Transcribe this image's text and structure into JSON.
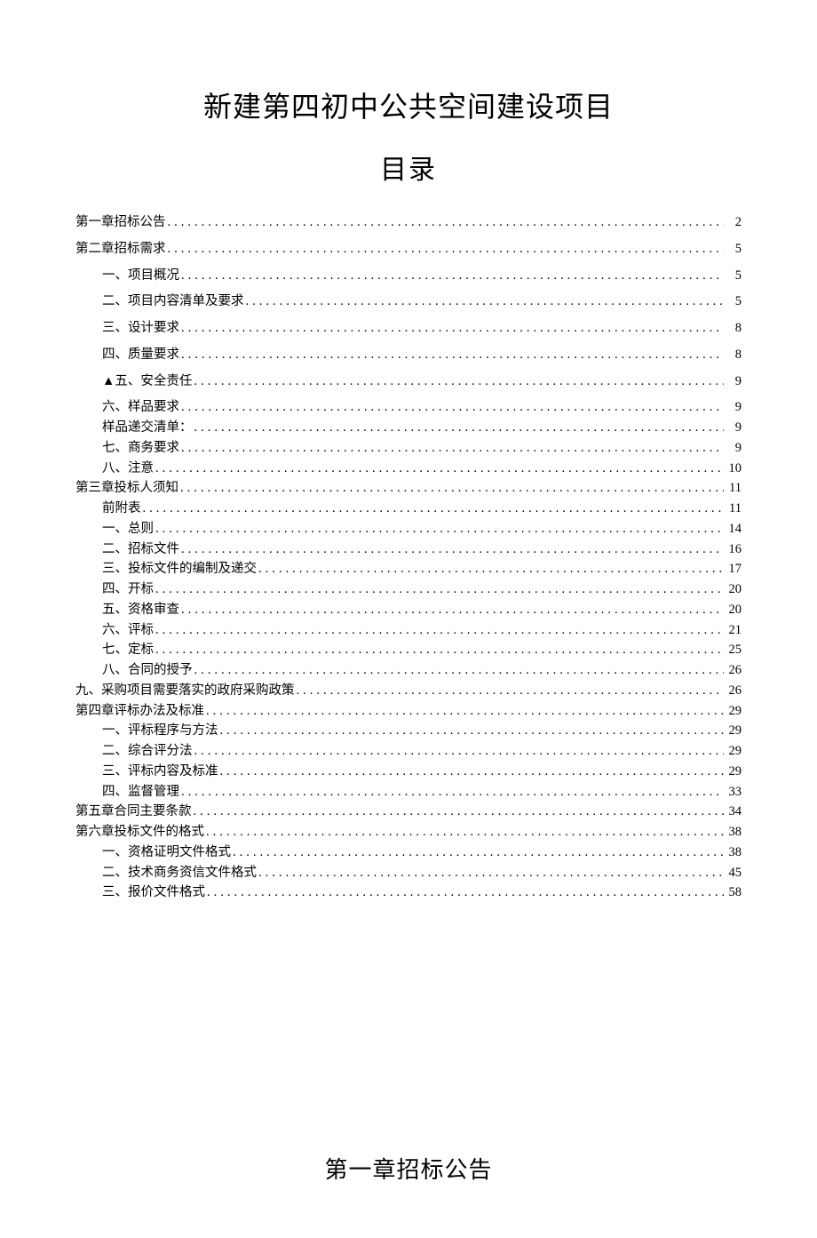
{
  "title": "新建第四初中公共空间建设项目",
  "subtitle": "目录",
  "chapter_heading": "第一章招标公告",
  "toc": [
    {
      "label": "第一章招标公告",
      "page": "2",
      "level": 0,
      "spaced": true
    },
    {
      "label": "第二章招标需求",
      "page": "5",
      "level": 0,
      "spaced": true
    },
    {
      "label": "一、项目概况",
      "page": "5",
      "level": 1,
      "spaced": true
    },
    {
      "label": "二、项目内容清单及要求",
      "page": "5",
      "level": 1,
      "spaced": true
    },
    {
      "label": "三、设计要求",
      "page": "8",
      "level": 1,
      "spaced": true
    },
    {
      "label": "四、质量要求",
      "page": "8",
      "level": 1,
      "spaced": true
    },
    {
      "label": "▲五、安全责任",
      "page": "9",
      "level": 1,
      "spaced": true
    },
    {
      "label": "六、样品要求",
      "page": "9",
      "level": 1,
      "spaced": false
    },
    {
      "label": "样品递交清单：",
      "page": "9",
      "level": 1,
      "spaced": false
    },
    {
      "label": "七、商务要求",
      "page": "9",
      "level": 1,
      "spaced": false
    },
    {
      "label": "八、注意",
      "page": "10",
      "level": 1,
      "spaced": false
    },
    {
      "label": "第三章投标人须知",
      "page": "11",
      "level": 0,
      "spaced": false
    },
    {
      "label": "前附表",
      "page": "11",
      "level": 1,
      "spaced": false
    },
    {
      "label": "一、总则",
      "page": "14",
      "level": 1,
      "spaced": false
    },
    {
      "label": "二、招标文件",
      "page": "16",
      "level": 1,
      "spaced": false
    },
    {
      "label": "三、投标文件的编制及递交",
      "page": "17",
      "level": 1,
      "spaced": false
    },
    {
      "label": "四、开标",
      "page": "20",
      "level": 1,
      "spaced": false
    },
    {
      "label": "五、资格审查",
      "page": "20",
      "level": 1,
      "spaced": false
    },
    {
      "label": "六、评标",
      "page": "21",
      "level": 1,
      "spaced": false
    },
    {
      "label": "七、定标",
      "page": "25",
      "level": 1,
      "spaced": false
    },
    {
      "label": "八、合同的授予",
      "page": "26",
      "level": 1,
      "spaced": false
    },
    {
      "label": "九、采购项目需要落实的政府采购政策",
      "page": "26",
      "level": 0,
      "spaced": false
    },
    {
      "label": "第四章评标办法及标准",
      "page": "29",
      "level": 0,
      "spaced": false
    },
    {
      "label": "一、评标程序与方法",
      "page": "29",
      "level": 1,
      "spaced": false
    },
    {
      "label": "二、综合评分法",
      "page": "29",
      "level": 1,
      "spaced": false
    },
    {
      "label": "三、评标内容及标准",
      "page": "29",
      "level": 1,
      "spaced": false
    },
    {
      "label": "四、监督管理",
      "page": "33",
      "level": 1,
      "spaced": false
    },
    {
      "label": "第五章合同主要条款",
      "page": "34",
      "level": 0,
      "spaced": false
    },
    {
      "label": "第六章投标文件的格式",
      "page": "38",
      "level": 0,
      "spaced": false
    },
    {
      "label": "一、资格证明文件格式",
      "page": "38",
      "level": 1,
      "spaced": false
    },
    {
      "label": "二、技术商务资信文件格式",
      "page": "45",
      "level": 1,
      "spaced": false
    },
    {
      "label": "三、报价文件格式",
      "page": "58",
      "level": 1,
      "spaced": false
    }
  ]
}
